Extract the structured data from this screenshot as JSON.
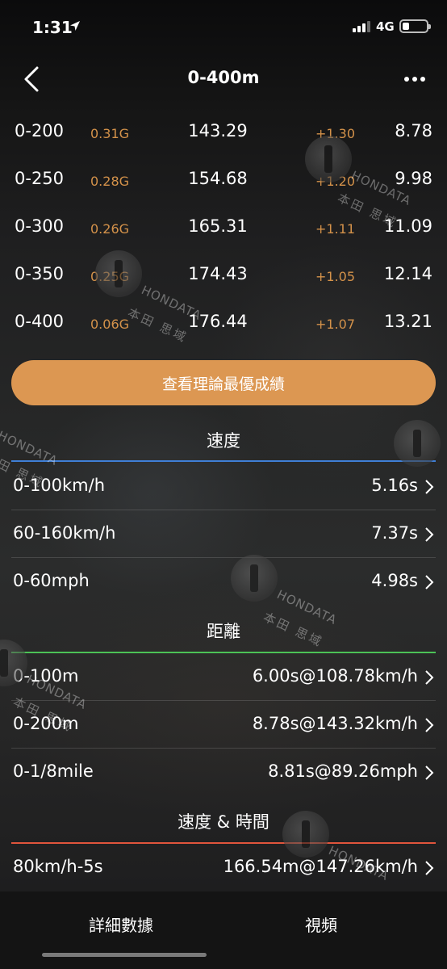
{
  "status_bar": {
    "time": "1:31",
    "network": "4G"
  },
  "nav": {
    "title": "0-400m"
  },
  "splits": [
    {
      "range": "0-200",
      "g": "0.31G",
      "speed": "143.29",
      "delta": "+1.30",
      "time": "8.78"
    },
    {
      "range": "0-250",
      "g": "0.28G",
      "speed": "154.68",
      "delta": "+1.20",
      "time": "9.98"
    },
    {
      "range": "0-300",
      "g": "0.26G",
      "speed": "165.31",
      "delta": "+1.11",
      "time": "11.09"
    },
    {
      "range": "0-350",
      "g": "0.25G",
      "speed": "174.43",
      "delta": "+1.05",
      "time": "12.14"
    },
    {
      "range": "0-400",
      "g": "0.06G",
      "speed": "176.44",
      "delta": "+1.07",
      "time": "13.21"
    }
  ],
  "best_button": {
    "label": "查看理論最優成績"
  },
  "sections": {
    "speed": {
      "title": "速度",
      "line_color": "#3f7fd6",
      "rows": [
        {
          "label": "0-100km/h",
          "value": "5.16s"
        },
        {
          "label": "60-160km/h",
          "value": "7.37s"
        },
        {
          "label": "0-60mph",
          "value": "4.98s"
        }
      ]
    },
    "distance": {
      "title": "距離",
      "line_color": "#4cc256",
      "rows": [
        {
          "label": "0-100m",
          "value": "6.00s@108.78km/h"
        },
        {
          "label": "0-200m",
          "value": "8.78s@143.32km/h"
        },
        {
          "label": "0-1/8mile",
          "value": "8.81s@89.26mph"
        }
      ]
    },
    "speed_time": {
      "title": "速度 & 時間",
      "line_color": "#e0553c",
      "rows": [
        {
          "label": "80km/h-5s",
          "value": "166.54m@147.26km/h"
        }
      ]
    }
  },
  "watermark": {
    "text_en": "HONDATA",
    "text_cn": "本田 思域"
  },
  "tabs": [
    {
      "label": "詳細數據"
    },
    {
      "label": "視頻"
    }
  ]
}
